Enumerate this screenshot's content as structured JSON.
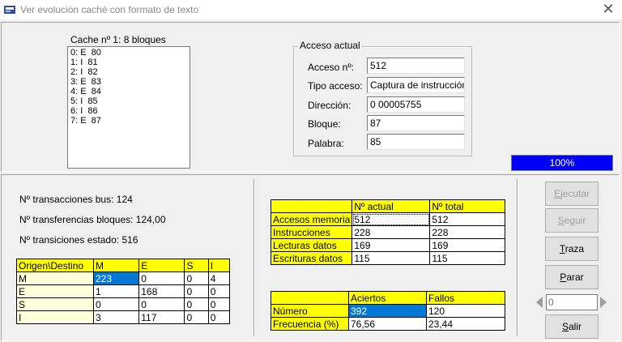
{
  "window": {
    "title": "Ver evolución caché con formato de texto",
    "close_glyph": "✕"
  },
  "cache": {
    "label": "Cache nº 1: 8 bloques",
    "items": [
      "0: E  80",
      "1: I  81",
      "2: I  82",
      "3: E  83",
      "4: E  84",
      "5: I  85",
      "6: I  86",
      "7: E  87"
    ]
  },
  "access": {
    "group_title": "Acceso actual",
    "fields": [
      {
        "label": "Acceso nº:",
        "value": "512"
      },
      {
        "label": "Tipo acceso:",
        "value": "Captura de instrucción"
      },
      {
        "label": "Dirección:",
        "value": "0 00005755"
      },
      {
        "label": "Bloque:",
        "value": "87"
      },
      {
        "label": "Palabra:",
        "value": "85"
      }
    ]
  },
  "progress": {
    "value": 1.0,
    "label": "100%",
    "color": "#0000f8"
  },
  "stats": {
    "bus_transactions": "Nº transacciones bus: 124",
    "block_transfers": "Nº transferencias bloques: 124,00",
    "state_transitions": "Nº transiciones estado: 516"
  },
  "transition_table": {
    "corner": "Origen\\Destino",
    "cols": [
      "M",
      "E",
      "S",
      "I"
    ],
    "rows": [
      {
        "h": "M",
        "v": [
          "223",
          "0",
          "0",
          "4"
        ]
      },
      {
        "h": "E",
        "v": [
          "1",
          "168",
          "0",
          "0"
        ]
      },
      {
        "h": "S",
        "v": [
          "0",
          "0",
          "0",
          "0"
        ]
      },
      {
        "h": "I",
        "v": [
          "3",
          "117",
          "0",
          "0"
        ]
      }
    ]
  },
  "access_table": {
    "cols": [
      "Nº actual",
      "Nº total"
    ],
    "rows": [
      {
        "h": "Accesos memoria",
        "v": [
          "512",
          "512"
        ]
      },
      {
        "h": "Instrucciones",
        "v": [
          "228",
          "228"
        ]
      },
      {
        "h": "Lecturas datos",
        "v": [
          "169",
          "169"
        ]
      },
      {
        "h": "Escrituras datos",
        "v": [
          "115",
          "115"
        ]
      }
    ]
  },
  "hits_table": {
    "cols": [
      "Aciertos",
      "Fallos"
    ],
    "rows": [
      {
        "h": "Número",
        "v": [
          "392",
          "120"
        ]
      },
      {
        "h": "Frecuencia (%)",
        "v": [
          "76,56",
          "23,44"
        ]
      }
    ]
  },
  "buttons": {
    "ejecutar": {
      "u": "E",
      "rest": "jecutar"
    },
    "seguir": {
      "u": "S",
      "rest": "eguir"
    },
    "traza": {
      "u": "T",
      "rest": "raza"
    },
    "parar": {
      "u": "P",
      "rest": "arar"
    },
    "salir": {
      "u": "S",
      "rest": "alir"
    }
  },
  "spinner": {
    "value": "0"
  },
  "colors": {
    "header": "#ffff00",
    "row_header": "#ffffdc",
    "selection": "#0078d7"
  }
}
